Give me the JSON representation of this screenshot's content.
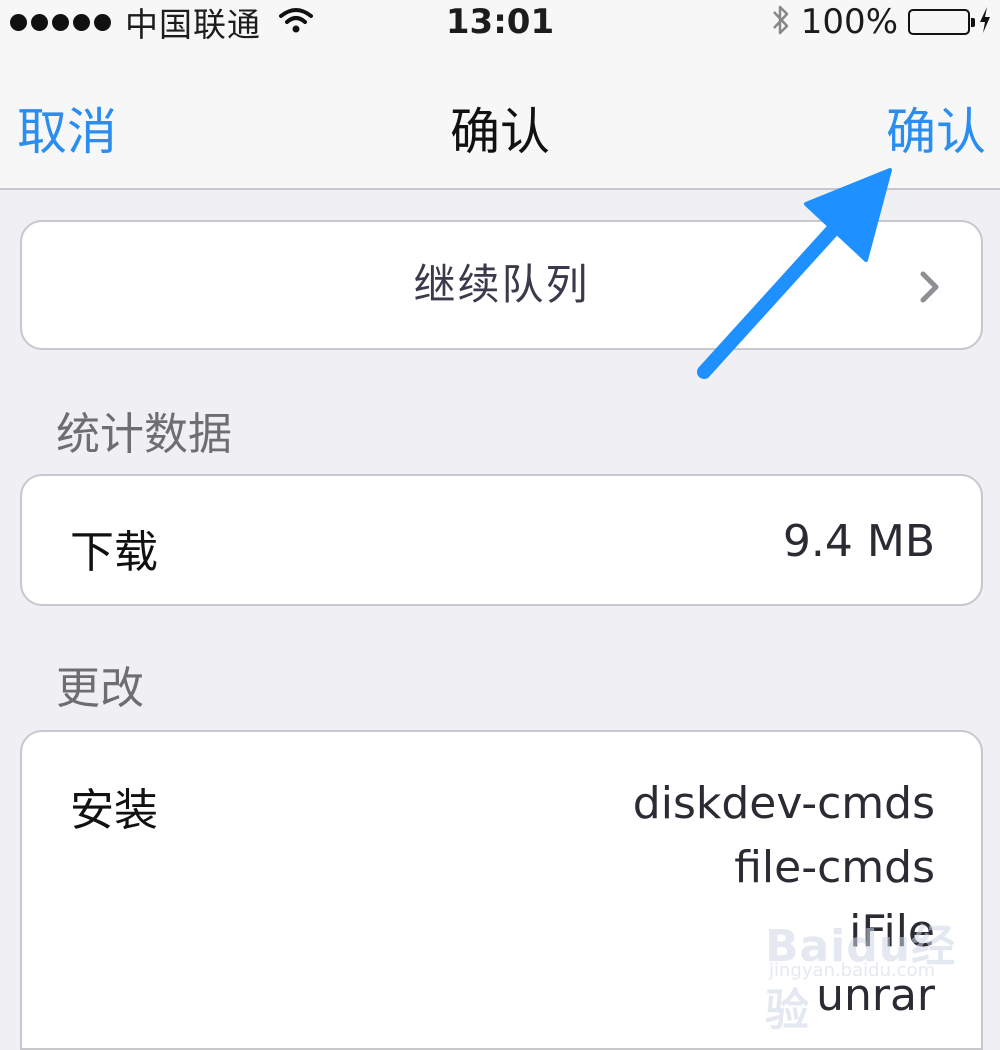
{
  "status_bar": {
    "carrier": "中国联通",
    "time": "13:01",
    "battery_percent": "100%",
    "signal_icon": "signal-dots-icon",
    "wifi_icon": "wifi-icon",
    "bluetooth_icon": "bluetooth-icon",
    "battery_icon": "battery-icon",
    "charging_icon": "charging-bolt-icon",
    "battery_color": "#4cd964"
  },
  "nav": {
    "cancel_label": "取消",
    "title": "确认",
    "confirm_label": "确认",
    "accent_color": "#2a8ef0"
  },
  "queue": {
    "label": "继续队列",
    "chevron_icon": "chevron-right-icon"
  },
  "stats": {
    "header": "统计数据",
    "download_label": "下载",
    "download_value": "9.4 MB"
  },
  "changes": {
    "header": "更改",
    "install_label": "安装",
    "packages": [
      "diskdev-cmds",
      "file-cmds",
      "iFile",
      "unrar"
    ]
  },
  "annotation": {
    "arrow_icon": "arrow-pointer-icon",
    "arrow_color": "#1e90ff"
  },
  "watermark": {
    "main": "Baidu经验",
    "sub": "jingyan.baidu.com"
  }
}
